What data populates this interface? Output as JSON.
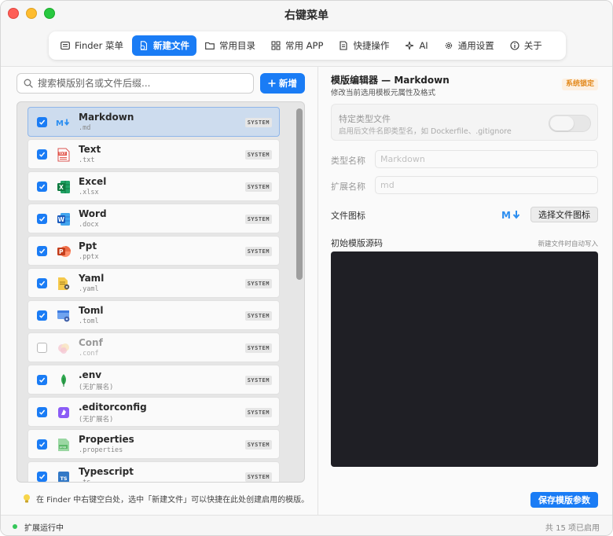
{
  "window": {
    "title": "右键菜单"
  },
  "colors": {
    "accent": "#1a7cf5",
    "warning": "#e38a1e",
    "status_ok": "#34c759"
  },
  "tabs": [
    {
      "label": "Finder 菜单",
      "icon": "finder-menu-icon",
      "active": false
    },
    {
      "label": "新建文件",
      "icon": "new-file-icon",
      "active": true
    },
    {
      "label": "常用目录",
      "icon": "folder-icon",
      "active": false
    },
    {
      "label": "常用 APP",
      "icon": "apps-grid-icon",
      "active": false
    },
    {
      "label": "快捷操作",
      "icon": "quick-action-icon",
      "active": false
    },
    {
      "label": "AI",
      "icon": "sparkle-icon",
      "active": false
    },
    {
      "label": "通用设置",
      "icon": "gear-icon",
      "active": false
    },
    {
      "label": "关于",
      "icon": "info-icon",
      "active": false
    }
  ],
  "search": {
    "placeholder": "搜索模版别名或文件后缀...",
    "value": ""
  },
  "add_button": {
    "label": "新增"
  },
  "templates": [
    {
      "name": "Markdown",
      "ext": ".md",
      "badge": "SYSTEM",
      "checked": true,
      "selected": true,
      "icon": "markdown-icon"
    },
    {
      "name": "Text",
      "ext": ".txt",
      "badge": "SYSTEM",
      "checked": true,
      "selected": false,
      "icon": "text-file-icon"
    },
    {
      "name": "Excel",
      "ext": ".xlsx",
      "badge": "SYSTEM",
      "checked": true,
      "selected": false,
      "icon": "excel-icon"
    },
    {
      "name": "Word",
      "ext": ".docx",
      "badge": "SYSTEM",
      "checked": true,
      "selected": false,
      "icon": "word-icon"
    },
    {
      "name": "Ppt",
      "ext": ".pptx",
      "badge": "SYSTEM",
      "checked": true,
      "selected": false,
      "icon": "powerpoint-icon"
    },
    {
      "name": "Yaml",
      "ext": ".yaml",
      "badge": "SYSTEM",
      "checked": true,
      "selected": false,
      "icon": "yaml-icon"
    },
    {
      "name": "Toml",
      "ext": ".toml",
      "badge": "SYSTEM",
      "checked": true,
      "selected": false,
      "icon": "toml-icon"
    },
    {
      "name": "Conf",
      "ext": ".conf",
      "badge": "SYSTEM",
      "checked": false,
      "selected": false,
      "icon": "conf-icon"
    },
    {
      "name": ".env",
      "ext": "(无扩展名)",
      "badge": "SYSTEM",
      "checked": true,
      "selected": false,
      "icon": "env-leaf-icon"
    },
    {
      "name": ".editorconfig",
      "ext": "(无扩展名)",
      "badge": "SYSTEM",
      "checked": true,
      "selected": false,
      "icon": "editorconfig-icon"
    },
    {
      "name": "Properties",
      "ext": ".properties",
      "badge": "SYSTEM",
      "checked": true,
      "selected": false,
      "icon": "properties-icon"
    },
    {
      "name": "Typescript",
      "ext": ".ts",
      "badge": "SYSTEM",
      "checked": true,
      "selected": false,
      "icon": "typescript-icon"
    }
  ],
  "hint": {
    "text": "在 Finder 中右键空白处，选中「新建文件」可以快捷在此处创建启用的模版。"
  },
  "editor": {
    "title": "模版编辑器 — Markdown",
    "subtitle": "修改当前选用模板元属性及格式",
    "lock_badge": "系统锁定",
    "specific_type": {
      "title": "特定类型文件",
      "subtitle": "启用后文件名即类型名，如 Dockerfile、.gitignore",
      "enabled": false
    },
    "type_name": {
      "label": "类型名称",
      "placeholder": "Markdown",
      "value": ""
    },
    "ext_name": {
      "label": "扩展名称",
      "placeholder": "md",
      "value": ""
    },
    "file_icon": {
      "label": "文件图标",
      "button": "选择文件图标",
      "icon": "markdown-icon"
    },
    "source": {
      "label": "初始模版源码",
      "note": "新建文件时自动写入",
      "value": ""
    },
    "save_button": "保存模版参数"
  },
  "statusbar": {
    "status": "扩展运行中",
    "count": "共 15 项已启用"
  }
}
